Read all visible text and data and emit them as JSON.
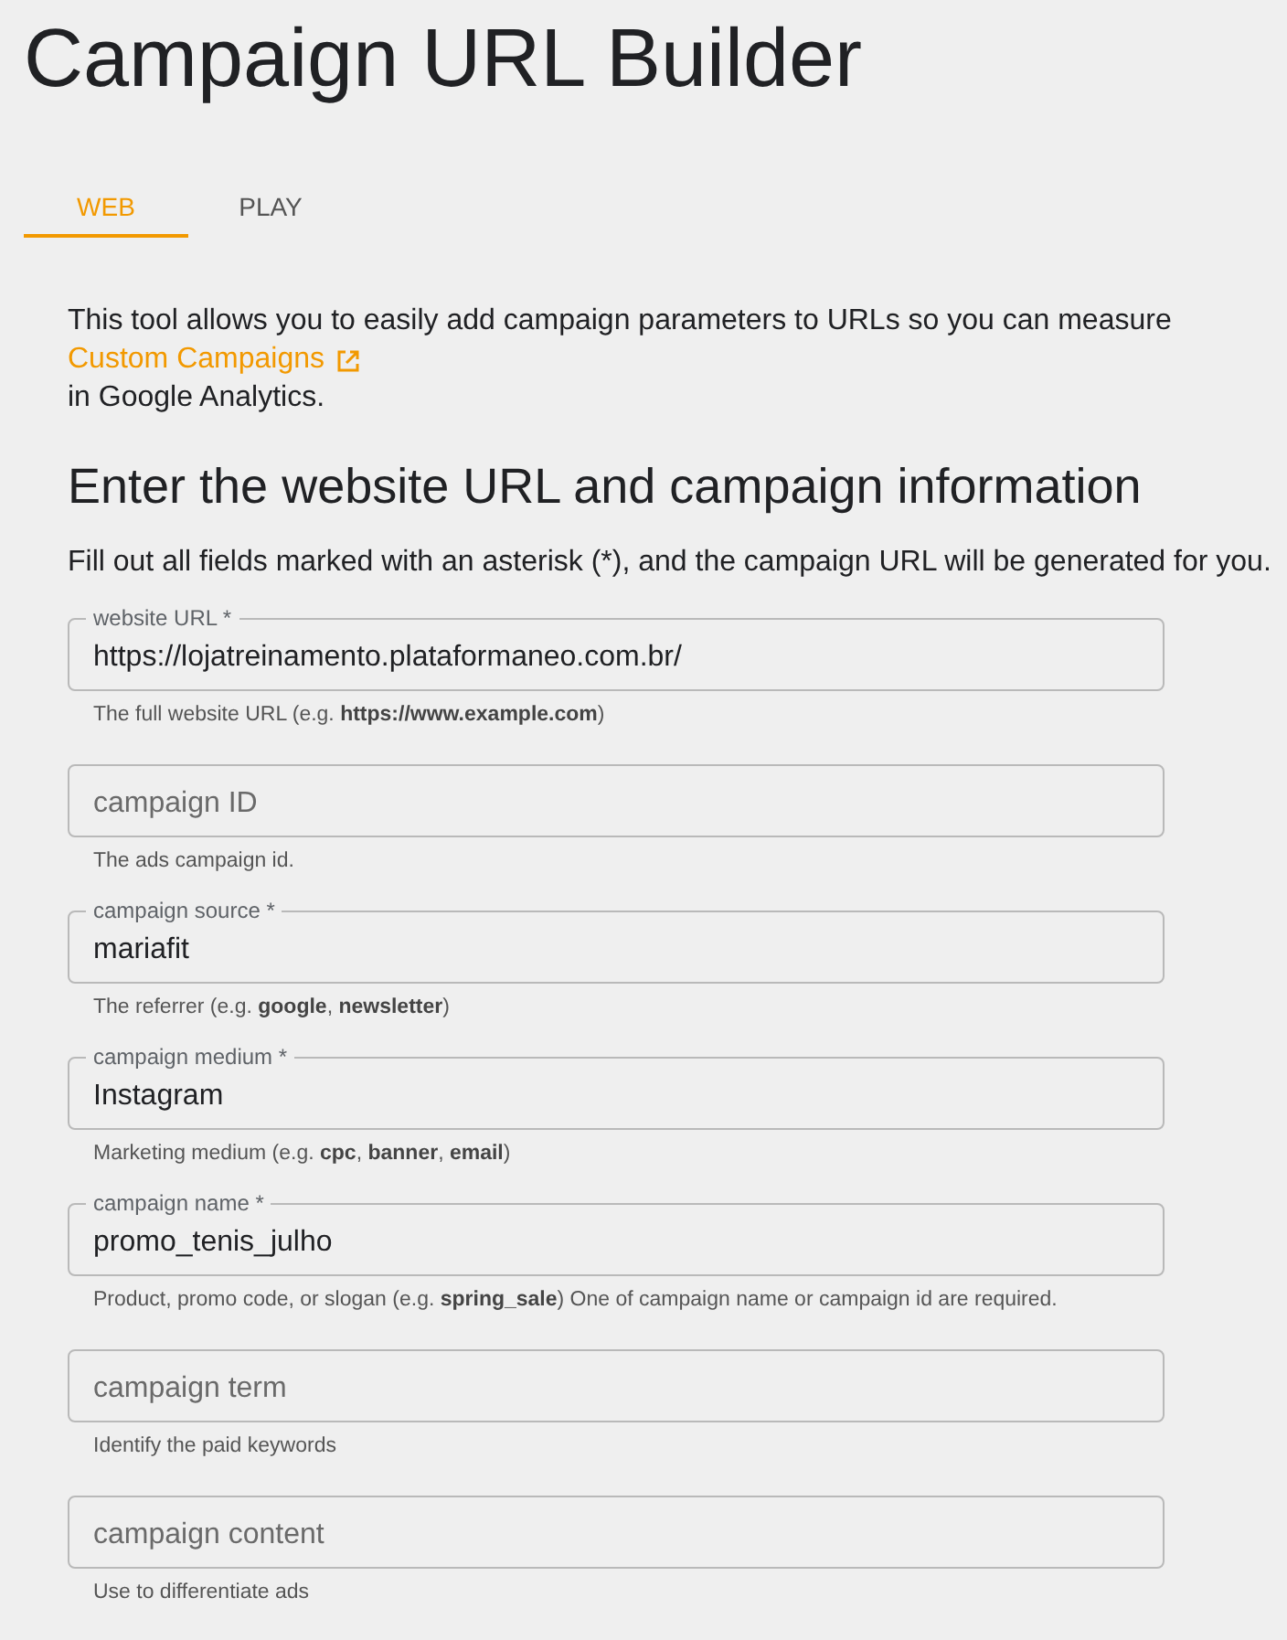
{
  "title": "Campaign URL Builder",
  "tabs": [
    {
      "label": "WEB",
      "selected": true
    },
    {
      "label": "PLAY",
      "selected": false
    }
  ],
  "intro": {
    "text": "This tool allows you to easily add campaign parameters to URLs so you can measure",
    "link": "Custom Campaigns",
    "suffix": "in Google Analytics."
  },
  "heading": "Enter the website URL and campaign information",
  "instructions": "Fill out all fields marked with an asterisk (*), and the campaign URL will be generated for you.",
  "fields": [
    {
      "label": "website URL *",
      "value": "https://lojatreinamento.plataformaneo.com.br/",
      "helper": "The full website URL (e.g. **https://www.example.com**)"
    },
    {
      "placeholder": "campaign ID",
      "helper": "The ads campaign id."
    },
    {
      "label": "campaign source *",
      "value": "mariafit",
      "helper": "The referrer (e.g. **google**, **newsletter**)"
    },
    {
      "label": "campaign medium *",
      "value": "Instagram",
      "helper": "Marketing medium (e.g. **cpc**, **banner**, **email**)"
    },
    {
      "label": "campaign name *",
      "value": "promo_tenis_julho",
      "helper": "Product, promo code, or slogan (e.g. **spring_sale**) One of campaign name or campaign id are required."
    },
    {
      "placeholder": "campaign term",
      "helper": "Identify the paid keywords"
    },
    {
      "placeholder": "campaign content",
      "helper": "Use to differentiate ads"
    }
  ]
}
